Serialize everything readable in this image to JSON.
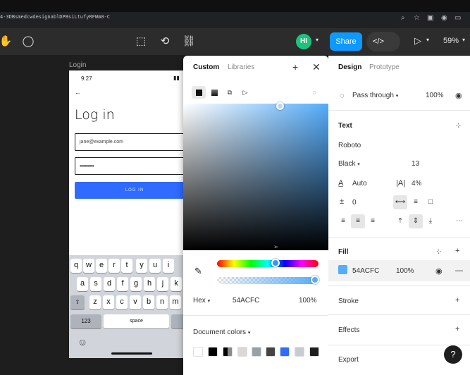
{
  "browser": {
    "url": "4-3DBsmedcwdesignablDP8siLtufyRFWm0-C"
  },
  "toolbar": {
    "hand_icon": "hand-icon",
    "comment_icon": "comment-icon",
    "avatar": "HI",
    "share": "Share",
    "devmode": "</>",
    "play": "▷",
    "zoom": "59%"
  },
  "frame": {
    "label": "Login",
    "time": "9:27",
    "title": "Log in",
    "email_placeholder": "jane@example.com",
    "password": "•••••••••••",
    "login_button": "LOG IN",
    "keyboard": {
      "row1": [
        "q",
        "w",
        "e",
        "r",
        "t",
        "y",
        "u",
        "i"
      ],
      "row2": [
        "a",
        "s",
        "d",
        "f",
        "g",
        "h",
        "j",
        "k"
      ],
      "row3": [
        "z",
        "x",
        "c",
        "v",
        "b",
        "n",
        "m"
      ],
      "num": "123",
      "space": "space",
      "emoji": "☺"
    }
  },
  "picker": {
    "tab_custom": "Custom",
    "tab_libraries": "Libraries",
    "hex_label": "Hex",
    "hex_value": "54ACFC",
    "opacity": "100%",
    "doc_colors": "Document colors",
    "swatches": [
      "#ffffff",
      "#000000",
      "#1e1e1e",
      "#d9d9d9",
      "#9aa0a6",
      "#444444",
      "#2f6bff",
      "#c8ccd2",
      "#1e1e1e"
    ]
  },
  "panel": {
    "tab_design": "Design",
    "tab_prototype": "Prototype",
    "pass_through": "Pass through",
    "layer_opacity": "100%",
    "text_heading": "Text",
    "font": "Roboto",
    "weight": "Black",
    "size": "13",
    "line_height": "Auto",
    "letter_spacing": "4%",
    "para_spacing": "0",
    "fill_heading": "Fill",
    "fill_hex": "54ACFC",
    "fill_opacity": "100%",
    "stroke": "Stroke",
    "effects": "Effects",
    "export": "Export",
    "colors": {
      "fill": "#54acfc"
    }
  }
}
